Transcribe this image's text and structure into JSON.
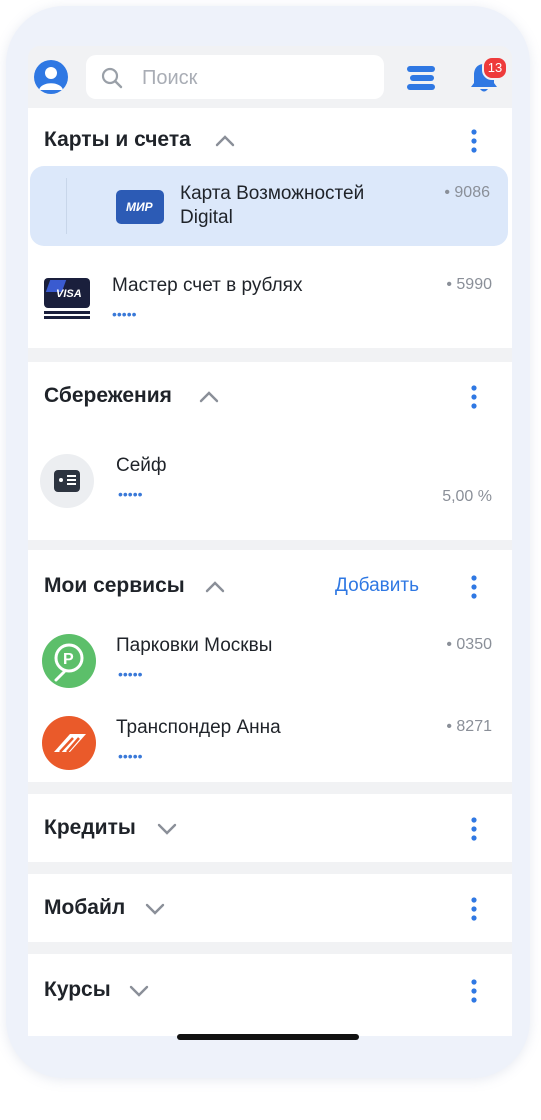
{
  "search": {
    "placeholder": "Поиск"
  },
  "notifications": {
    "count": "13"
  },
  "cards_section": {
    "title": "Карты и счета",
    "items": [
      {
        "title_line1": "Карта Возможностей",
        "title_line2": "Digital",
        "number": "• 9086",
        "brand": "МИР"
      },
      {
        "title": "Мастер счет в рублях",
        "number": "• 5990",
        "balance_hidden": "•••••",
        "brand": "VISA"
      }
    ]
  },
  "savings_section": {
    "title": "Сбережения",
    "items": [
      {
        "title": "Сейф",
        "balance_hidden": "•••••",
        "rate": "5,00 %"
      }
    ]
  },
  "services_section": {
    "title": "Мои сервисы",
    "add_label": "Добавить",
    "items": [
      {
        "title": "Парковки Москвы",
        "number": "• 0350",
        "balance_hidden": "•••••"
      },
      {
        "title": "Транспондер Анна",
        "number": "• 8271",
        "balance_hidden": "•••••"
      }
    ]
  },
  "collapsed_sections": [
    {
      "title": "Кредиты"
    },
    {
      "title": "Мобайл"
    },
    {
      "title": "Курсы"
    }
  ],
  "colors": {
    "accent": "#2f78e3",
    "selected_row": "#dce8fa",
    "badge": "#ee3b3b",
    "parking": "#5cbf6a",
    "transponder": "#ea5a2a"
  }
}
